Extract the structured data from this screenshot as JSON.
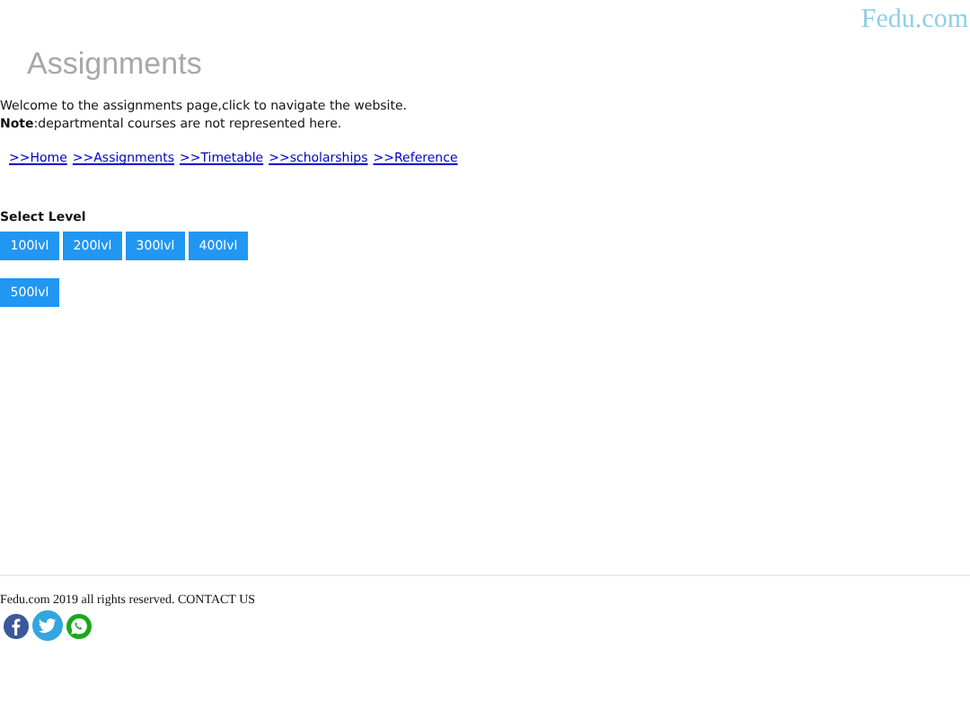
{
  "logo": "Fedu.com",
  "title": "Assignments",
  "intro": "Welcome to the assignments page,click to navigate the website.",
  "note": "**Note**:departmental courses are not represented here.",
  "nav_links": [
    ">>Home",
    ">>Assignments",
    ">>Timetable",
    ">>scholarships",
    ">>Reference"
  ],
  "level_heading": "Select Level",
  "level_buttons": [
    "100lvl",
    "200lvl",
    "300lvl",
    "400lvl",
    "500lvl"
  ],
  "footer": {
    "text": "Fedu.com 2019 all rights reserved. CONTACT US",
    "social": [
      {
        "kind": "facebook"
      },
      {
        "kind": "twitter"
      },
      {
        "kind": "whatsapp"
      }
    ]
  }
}
